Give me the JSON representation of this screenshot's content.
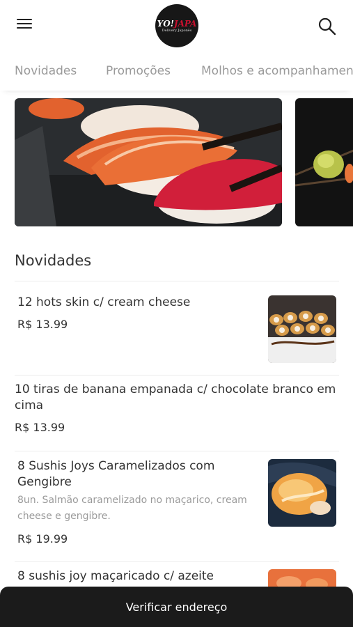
{
  "header": {
    "menu_icon": "hamburger-menu-icon",
    "search_icon": "search-icon",
    "logo": {
      "main_yo": "YO!",
      "main_japa": "JAPA",
      "sub": "Delivery Japonês"
    }
  },
  "tabs": [
    {
      "label": "Novidades"
    },
    {
      "label": "Promoções"
    },
    {
      "label": "Molhos e acompanhamentos"
    }
  ],
  "section": {
    "title": "Novidades"
  },
  "items": [
    {
      "name": "12 hots skin c/ cream cheese",
      "price": "R$ 13.99"
    },
    {
      "name": "10 tiras de banana empanada c/ chocolate branco em cima",
      "price": "R$ 13.99"
    },
    {
      "name": "8 Sushis Joys Caramelizados com Gengibre",
      "description": "8un. Salmão caramelizado no maçarico, cream cheese e gengibre.",
      "price": "R$ 19.99"
    },
    {
      "name": "8 sushis joy maçaricado c/ azeite"
    }
  ],
  "bottom_bar": {
    "label": "Verificar endereço"
  },
  "colors": {
    "brand_red": "#c8102e",
    "bottom_bar": "#1b1b1b",
    "tab_text": "#9a9a9a"
  }
}
